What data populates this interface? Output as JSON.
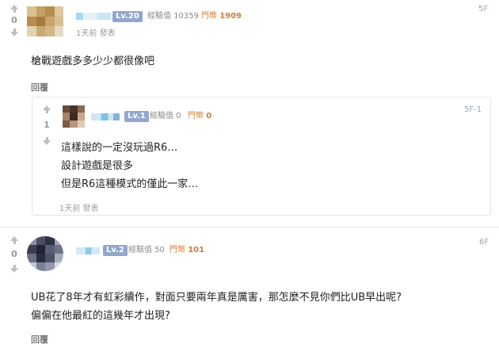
{
  "post1": {
    "votes": "0",
    "level": "Lv.20",
    "exp_label": "經驗值",
    "exp_value": "10359",
    "coin_label": "門幣",
    "coin_value": "1909",
    "time": "1天前 發表",
    "floor": "5F",
    "content": "槍戰遊戲多多少少都很像吧",
    "reply_label": "回覆"
  },
  "subreply": {
    "votes": "1",
    "level": "Lv.1",
    "exp_label": "經驗值",
    "exp_value": "0",
    "coin_label": "門幣",
    "coin_value": "0",
    "floor": "5F-1",
    "lines": [
      "這樣說的一定沒玩過R6…",
      "設計遊戲是很多",
      "但是R6這種模式的僅此一家…"
    ],
    "time": "1天前 發表"
  },
  "post2": {
    "votes": "0",
    "level": "Lv.2",
    "exp_label": "經驗值",
    "exp_value": "50",
    "coin_label": "門幣",
    "coin_value": "101",
    "floor": "6F",
    "lines": [
      "UB花了8年才有虹彩續作，對面只要兩年真是厲害，那怎麼不見你們比UB早出呢?",
      "偏偏在他最紅的這幾年才出現?"
    ],
    "reply_label": "回覆"
  },
  "colors": {
    "level_badge": "#93a6ce",
    "coin": "#d07c3a"
  }
}
